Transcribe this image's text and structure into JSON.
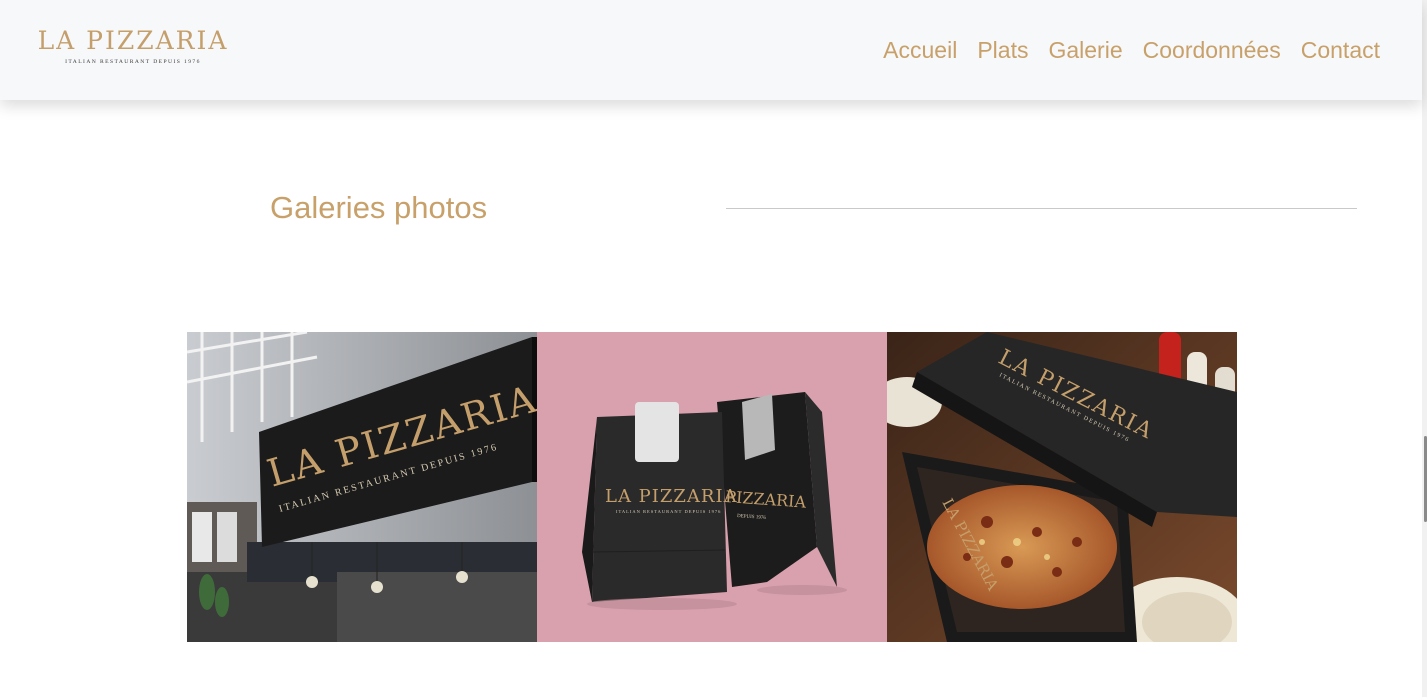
{
  "brand": {
    "name": "LA PIZZARIA",
    "tagline": "ITALIAN RESTAURANT DEPUIS 1976"
  },
  "nav": {
    "items": [
      {
        "label": "Accueil"
      },
      {
        "label": "Plats"
      },
      {
        "label": "Galerie"
      },
      {
        "label": "Coordonnées"
      },
      {
        "label": "Contact"
      }
    ]
  },
  "gallery": {
    "title": "Galeries photos",
    "photos": [
      {
        "name": "storefront-sign-photo",
        "sign_main": "LA PIZZARIA",
        "sign_sub": "ITALIAN RESTAURANT DEPUIS 1976"
      },
      {
        "name": "takeaway-bags-photo",
        "bag_main": "LA PIZZARIA",
        "bag_sub": "ITALIAN RESTAURANT DEPUIS 1976",
        "bag_back": "PIZZARIA",
        "bag_back_sub": "DEPUIS 1976"
      },
      {
        "name": "pizza-box-photo",
        "box_main": "LA PIZZARIA",
        "box_sub": "ITALIAN RESTAURANT DEPUIS 1976",
        "box_side": "LA PIZZARIA"
      }
    ]
  },
  "colors": {
    "accent_gold": "#c8a06a",
    "header_bg": "#f7f8fa",
    "rule": "#c9c9c9",
    "photo_pink": "#d9a1ae",
    "sign_black": "#1b1b1b"
  }
}
